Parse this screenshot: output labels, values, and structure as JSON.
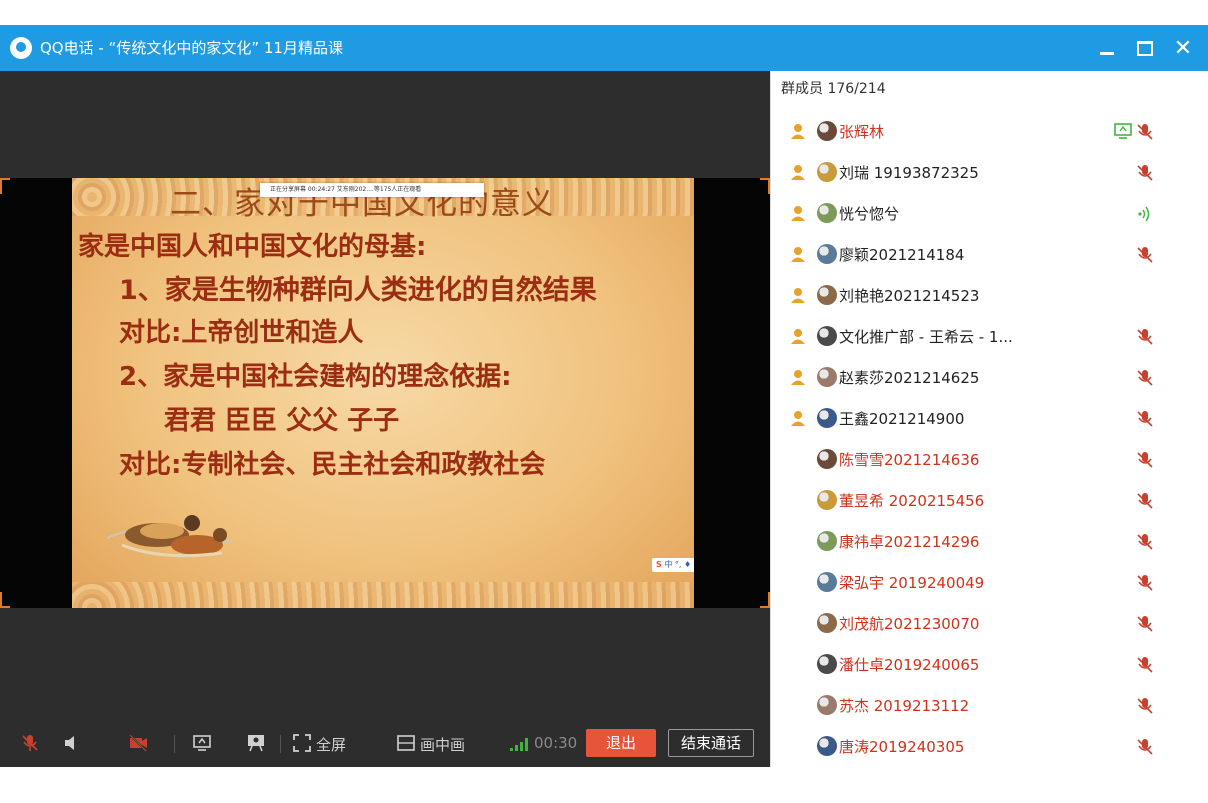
{
  "window": {
    "title": "QQ电话 -  “传统文化中的家文化” 11月精品课",
    "icons": {
      "app": "qq-penguin-icon",
      "minimize": "minimize-icon",
      "maximize": "maximize-icon",
      "close": "close-icon"
    },
    "close_label": "✕"
  },
  "slide": {
    "title": "二、家对于中国文化的意义",
    "share_banner": "正在分享屏幕   00:24:27    艾东刚202....等175人正在观看",
    "lines": [
      "家是中国人和中国文化的母基:",
      "1、家是生物种群向人类进化的自然结果",
      "对比:上帝创世和造人",
      "2、家是中国社会建构的理念依据:",
      "君君  臣臣  父父  子子",
      "对比:专制社会、民主社会和政教社会"
    ],
    "ime_bar": "中 °, ♦ ▦ ▦",
    "ime_logo": "S"
  },
  "toolbar": {
    "icons": {
      "mic": "mic-muted-icon",
      "speaker": "speaker-icon",
      "camera": "camera-off-icon",
      "share_screen": "share-screen-icon",
      "whiteboard": "presentation-icon",
      "fullscreen": "fullscreen-icon",
      "pip": "picture-in-picture-icon",
      "signal": "signal-icon"
    },
    "fullscreen_label": "全屏",
    "pip_label": "画中画",
    "timer": "00:30",
    "exit_label": "退出",
    "end_call_label": "结束通话"
  },
  "members": {
    "header": "群成员 176/214",
    "items": [
      {
        "name": "张辉林",
        "role": "member",
        "status": "muted",
        "extra": "screen-share",
        "name_color": "#d0311b"
      },
      {
        "name": "刘瑞  19193872325",
        "role": "member",
        "status": "muted",
        "name_color": "#222222"
      },
      {
        "name": "恍兮惚兮",
        "role": "member",
        "status": "speaking",
        "name_color": "#222222"
      },
      {
        "name": "廖颖2021214184",
        "role": "member",
        "status": "muted",
        "name_color": "#222222"
      },
      {
        "name": "刘艳艳2021214523",
        "role": "member",
        "status": "none",
        "name_color": "#222222"
      },
      {
        "name": "文化推广部 - 王希云 - 1...",
        "role": "member",
        "status": "muted",
        "name_color": "#222222"
      },
      {
        "name": "赵素莎2021214625",
        "role": "member",
        "status": "muted",
        "name_color": "#222222"
      },
      {
        "name": "王鑫2021214900",
        "role": "member",
        "status": "muted",
        "name_color": "#222222"
      },
      {
        "name": "陈雪雪2021214636",
        "role": "none",
        "status": "muted",
        "name_color": "#d0311b"
      },
      {
        "name": "董昱希  2020215456",
        "role": "none",
        "status": "muted",
        "name_color": "#d0311b"
      },
      {
        "name": "康祎卓2021214296",
        "role": "none",
        "status": "muted",
        "name_color": "#d0311b"
      },
      {
        "name": "梁弘宇  2019240049",
        "role": "none",
        "status": "muted",
        "name_color": "#d0311b"
      },
      {
        "name": "刘茂航2021230070",
        "role": "none",
        "status": "muted",
        "name_color": "#d0311b"
      },
      {
        "name": "潘仕卓2019240065",
        "role": "none",
        "status": "muted",
        "name_color": "#d0311b"
      },
      {
        "name": "苏杰  2019213112",
        "role": "none",
        "status": "muted",
        "name_color": "#d0311b"
      },
      {
        "name": "唐涛2019240305",
        "role": "none",
        "status": "muted",
        "name_color": "#d0311b"
      }
    ]
  },
  "colors": {
    "titlebar": "#1e9be2",
    "exit_button": "#e8543a",
    "muted_icon": "#c8412e",
    "speaking_icon": "#3db83a",
    "admin_icon": "#e6a229",
    "highlight_name": "#d0311b"
  }
}
